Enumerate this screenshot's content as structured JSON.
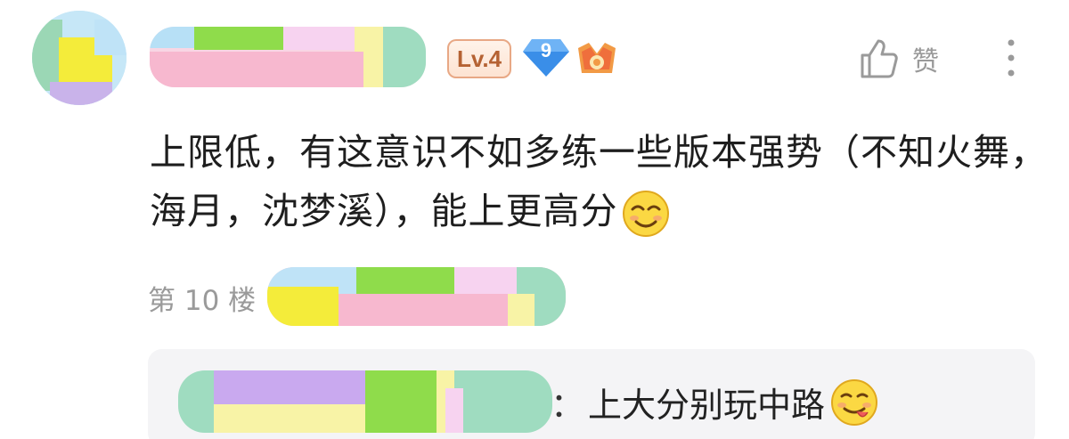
{
  "user": {
    "level_badge": "Lv.4",
    "gem_badge_number": "9",
    "avatar_icon": "avatar-blurred",
    "honor_icon": "crown-honor-icon"
  },
  "actions": {
    "like_label": "赞",
    "like_icon": "thumbs-up-icon",
    "more_icon": "more-vertical-icon"
  },
  "comment": {
    "text": "上限低，有这意识不如多练一些版本强势（不知火舞，海月，沈梦溪），能上更高分",
    "emoji": "smirk-emoji"
  },
  "floor": {
    "label": "第 10 楼"
  },
  "reply": {
    "colon": "：",
    "text": "上大分别玩中路",
    "emoji": "tongue-out-emoji"
  },
  "colors": {
    "level_text": "#b56233",
    "level_border": "#e8a885",
    "gem_blue": "#3a8ee8",
    "muted_gray": "#9a9a9a",
    "reply_bg": "#f4f4f6"
  }
}
